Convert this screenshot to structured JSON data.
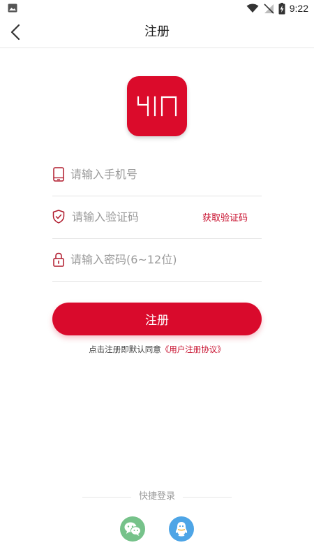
{
  "status_bar": {
    "time": "9:22",
    "icons": [
      "image-icon",
      "wifi-icon",
      "no-signal-icon",
      "battery-charging-icon"
    ]
  },
  "header": {
    "title": "注册",
    "back_icon": "chevron-left-icon"
  },
  "logo": {
    "text": "YIN",
    "bg_color": "#db0b2b"
  },
  "form": {
    "phone": {
      "placeholder": "请输入手机号",
      "value": "",
      "icon": "phone-icon"
    },
    "code": {
      "placeholder": "请输入验证码",
      "value": "",
      "icon": "shield-icon",
      "get_code_label": "获取验证码"
    },
    "password": {
      "placeholder": "请输入密码(6~12位)",
      "value": "",
      "icon": "lock-icon"
    },
    "submit_label": "注册"
  },
  "agreement": {
    "prefix": "点击注册即默认同意",
    "link": "《用户注册协议》"
  },
  "quick_login": {
    "label": "快捷登录",
    "providers": [
      "wechat-icon",
      "qq-icon"
    ]
  },
  "colors": {
    "accent": "#d90a2c",
    "link": "#c8102e",
    "wechat": "#76c28a",
    "qq": "#4ea5e6"
  }
}
